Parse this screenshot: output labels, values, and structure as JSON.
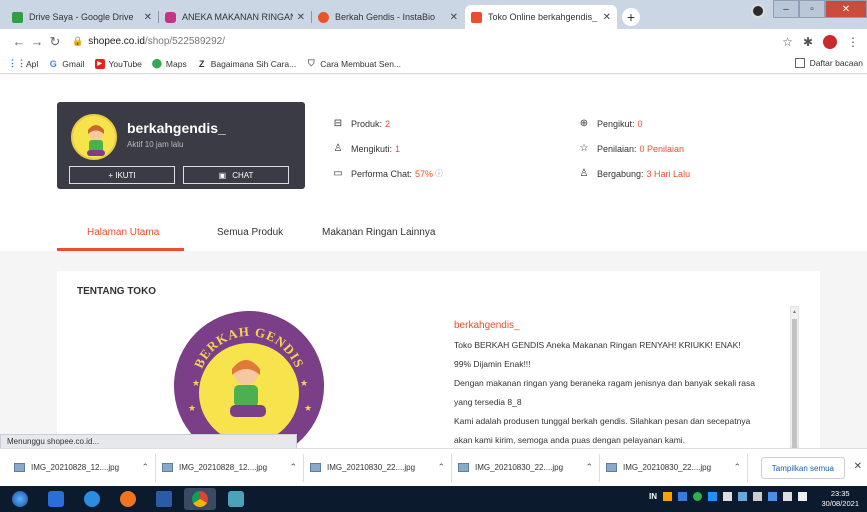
{
  "browser": {
    "tabs": [
      {
        "title": "Drive Saya - Google Drive",
        "color": "#2f9e44",
        "active": false
      },
      {
        "title": "ANEKA MAKANAN RINGAN (@b",
        "color": "#c13584",
        "active": false
      },
      {
        "title": "Berkah Gendis - InstaBio",
        "color": "#e8552b",
        "active": false
      },
      {
        "title": "Toko Online berkahgendis_ | Sho",
        "color": "#ee4d2d",
        "active": true
      }
    ],
    "new_tab_label": "+",
    "url_host": "shopee.co.id",
    "url_path": "/shop/522589292/",
    "bookmarks": [
      {
        "label": "Apl",
        "icon": "apps-icon",
        "color": "#1a73e8"
      },
      {
        "label": "Gmail",
        "icon": "google-icon",
        "color": "#4285f4"
      },
      {
        "label": "YouTube",
        "icon": "youtube-icon",
        "color": "#e62117"
      },
      {
        "label": "Maps",
        "icon": "maps-icon",
        "color": "#34a853"
      },
      {
        "label": "Bagaimana Sih Cara...",
        "icon": "z-icon",
        "color": "#222222"
      },
      {
        "label": "Cara Membuat Sen...",
        "icon": "bag-icon",
        "color": "#6a6a6a"
      }
    ],
    "reading_list_label": "Daftar bacaan",
    "status_text": "Menunggu shopee.co.id..."
  },
  "shop": {
    "name": "berkahgendis_",
    "active_text": "Aktif 10 jam lalu",
    "follow_label": "+ IKUTI",
    "chat_label": "CHAT",
    "stats": {
      "products_label": "Produk:",
      "products_value": "2",
      "following_label": "Mengikuti:",
      "following_value": "1",
      "chat_perf_label": "Performa Chat:",
      "chat_perf_value": "57%",
      "followers_label": "Pengikut:",
      "followers_value": "0",
      "rating_label": "Penilaian:",
      "rating_value": "0 Penilaian",
      "joined_label": "Bergabung:",
      "joined_value": "3 Hari Lalu"
    },
    "tabs": [
      "Halaman Utama",
      "Semua Produk",
      "Makanan Ringan Lainnya"
    ],
    "about_title": "TENTANG TOKO",
    "logo_text": "BERKAH GENDIS",
    "desc_name": "berkahgendis_",
    "desc_lines": [
      "Toko BERKAH GENDIS Aneka Makanan Ringan RENYAH! KRIUKK! ENAK!",
      "99% Dijamin Enak!!!",
      "Dengan makanan ringan yang beraneka ragam jenisnya dan banyak sekali rasa",
      "yang tersedia 8_8",
      "Kami adalah produsen tunggal berkah gendis. Silahkan pesan dan secepatnya",
      "akan kami kirim, semoga anda puas dengan pelayanan kami."
    ],
    "accent": "#ee4d2d"
  },
  "downloads": {
    "items": [
      "IMG_20210828_12....jpg",
      "IMG_20210828_12....jpg",
      "IMG_20210830_22....jpg",
      "IMG_20210830_22....jpg",
      "IMG_20210830_22....jpg"
    ],
    "show_all_label": "Tampilkan semua"
  },
  "taskbar": {
    "lang": "IN",
    "time": "23:35",
    "date": "30/08/2021"
  }
}
